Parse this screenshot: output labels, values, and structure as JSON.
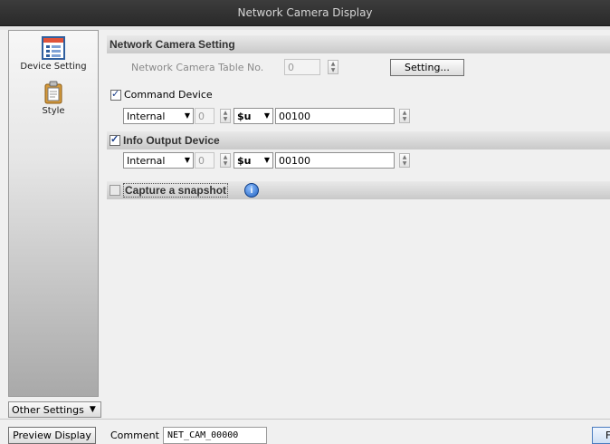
{
  "window": {
    "title": "Network Camera Display"
  },
  "sidebar": {
    "items": [
      {
        "label": "Device Setting",
        "icon": "device-setting-icon"
      },
      {
        "label": "Style",
        "icon": "style-icon"
      }
    ],
    "other_settings": "Other Settings"
  },
  "network_camera": {
    "header": "Network Camera Setting",
    "table_label": "Network Camera Table No.",
    "table_no": "0",
    "setting_button": "Setting..."
  },
  "command_device": {
    "label": "Command Device",
    "checked": true,
    "memory": "Internal",
    "station": "0",
    "device": "$u",
    "address": "00100"
  },
  "info_output_device": {
    "label": "Info Output Device",
    "checked": true,
    "memory": "Internal",
    "station": "0",
    "device": "$u",
    "address": "00100"
  },
  "snapshot": {
    "label": "Capture a snapshot",
    "checked": false,
    "icon": "info-icon"
  },
  "bottom": {
    "preview_button": "Preview Display",
    "comment_label": "Comment",
    "comment_value": "NET_CAM_00000",
    "right_button": "F"
  }
}
